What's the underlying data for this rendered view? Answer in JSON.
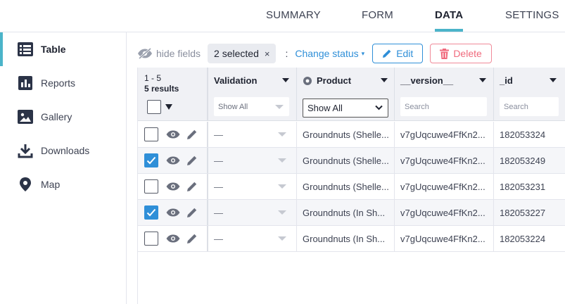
{
  "tabs": [
    {
      "label": "SUMMARY"
    },
    {
      "label": "FORM"
    },
    {
      "label": "DATA"
    },
    {
      "label": "SETTINGS"
    }
  ],
  "sidebar": {
    "items": [
      {
        "label": "Table",
        "icon": "table-icon"
      },
      {
        "label": "Reports",
        "icon": "bar-chart-icon"
      },
      {
        "label": "Gallery",
        "icon": "image-icon"
      },
      {
        "label": "Downloads",
        "icon": "download-icon"
      },
      {
        "label": "Map",
        "icon": "map-pin-icon"
      }
    ]
  },
  "toolbar": {
    "hide_fields": "hide fields",
    "selected": "2 selected",
    "close": "×",
    "colon": ":",
    "change_status": "Change status",
    "change_caret": "▾",
    "edit": "Edit",
    "delete": "Delete"
  },
  "table": {
    "range": "1 - 5",
    "count": "5 results",
    "columns": [
      {
        "label": "Validation",
        "filter": "Show All"
      },
      {
        "label": "Product",
        "filter": "Show All"
      },
      {
        "label": "__version__",
        "filter_placeholder": "Search"
      },
      {
        "label": "_id",
        "filter_placeholder": "Search"
      }
    ],
    "rows": [
      {
        "checked": false,
        "validation": "—",
        "product": "Groundnuts (Shelle...",
        "version": "v7gUqcuwe4FfKn2...",
        "id": "182053324"
      },
      {
        "checked": true,
        "validation": "—",
        "product": "Groundnuts (Shelle...",
        "version": "v7gUqcuwe4FfKn2...",
        "id": "182053249"
      },
      {
        "checked": false,
        "validation": "—",
        "product": "Groundnuts (Shelle...",
        "version": "v7gUqcuwe4FfKn2...",
        "id": "182053231"
      },
      {
        "checked": true,
        "validation": "—",
        "product": "Groundnuts (In Sh...",
        "version": "v7gUqcuwe4FfKn2...",
        "id": "182053227"
      },
      {
        "checked": false,
        "validation": "—",
        "product": "Groundnuts (In Sh...",
        "version": "v7gUqcuwe4FfKn2...",
        "id": "182053224"
      }
    ]
  },
  "colors": {
    "accent": "#4bb4c9",
    "primary": "#2f8fd8",
    "danger": "#f06a7d"
  }
}
